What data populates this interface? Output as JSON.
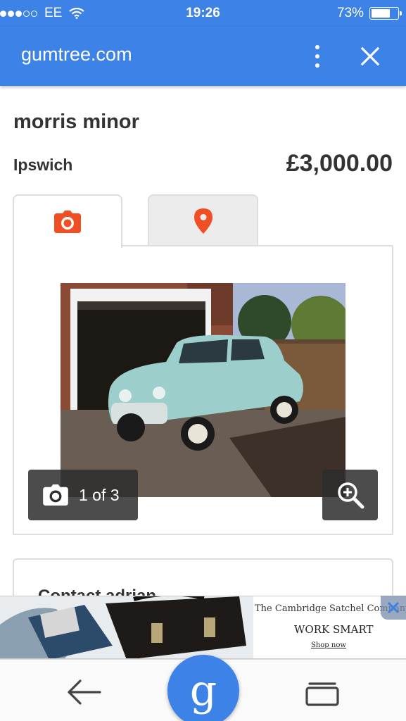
{
  "status_bar": {
    "carrier": "EE",
    "time": "19:26",
    "battery": "73%",
    "battery_level": 0.73
  },
  "browser": {
    "domain": "gumtree.com",
    "menu_icon": "more-vert-icon",
    "close_icon": "close-icon"
  },
  "listing": {
    "title": "morris minor",
    "location": "Ipswich",
    "price": "£3,000.00"
  },
  "media": {
    "tabs": [
      {
        "icon": "camera-icon",
        "active": true
      },
      {
        "icon": "map-pin-icon",
        "active": false
      }
    ],
    "counter": "1 of 3",
    "accent_color": "#f04e23"
  },
  "contact": {
    "title": "Contact adrian"
  },
  "ad": {
    "brand": "The Cambridge Satchel Company",
    "headline": "WORK SMART",
    "cta": "Shop now"
  },
  "bottom_nav": {
    "back_icon": "back-arrow-icon",
    "search_letter": "g",
    "tabs_icon": "tabs-icon"
  },
  "colors": {
    "primary": "#3d82e6",
    "text": "#333333",
    "border": "#dddddd"
  }
}
